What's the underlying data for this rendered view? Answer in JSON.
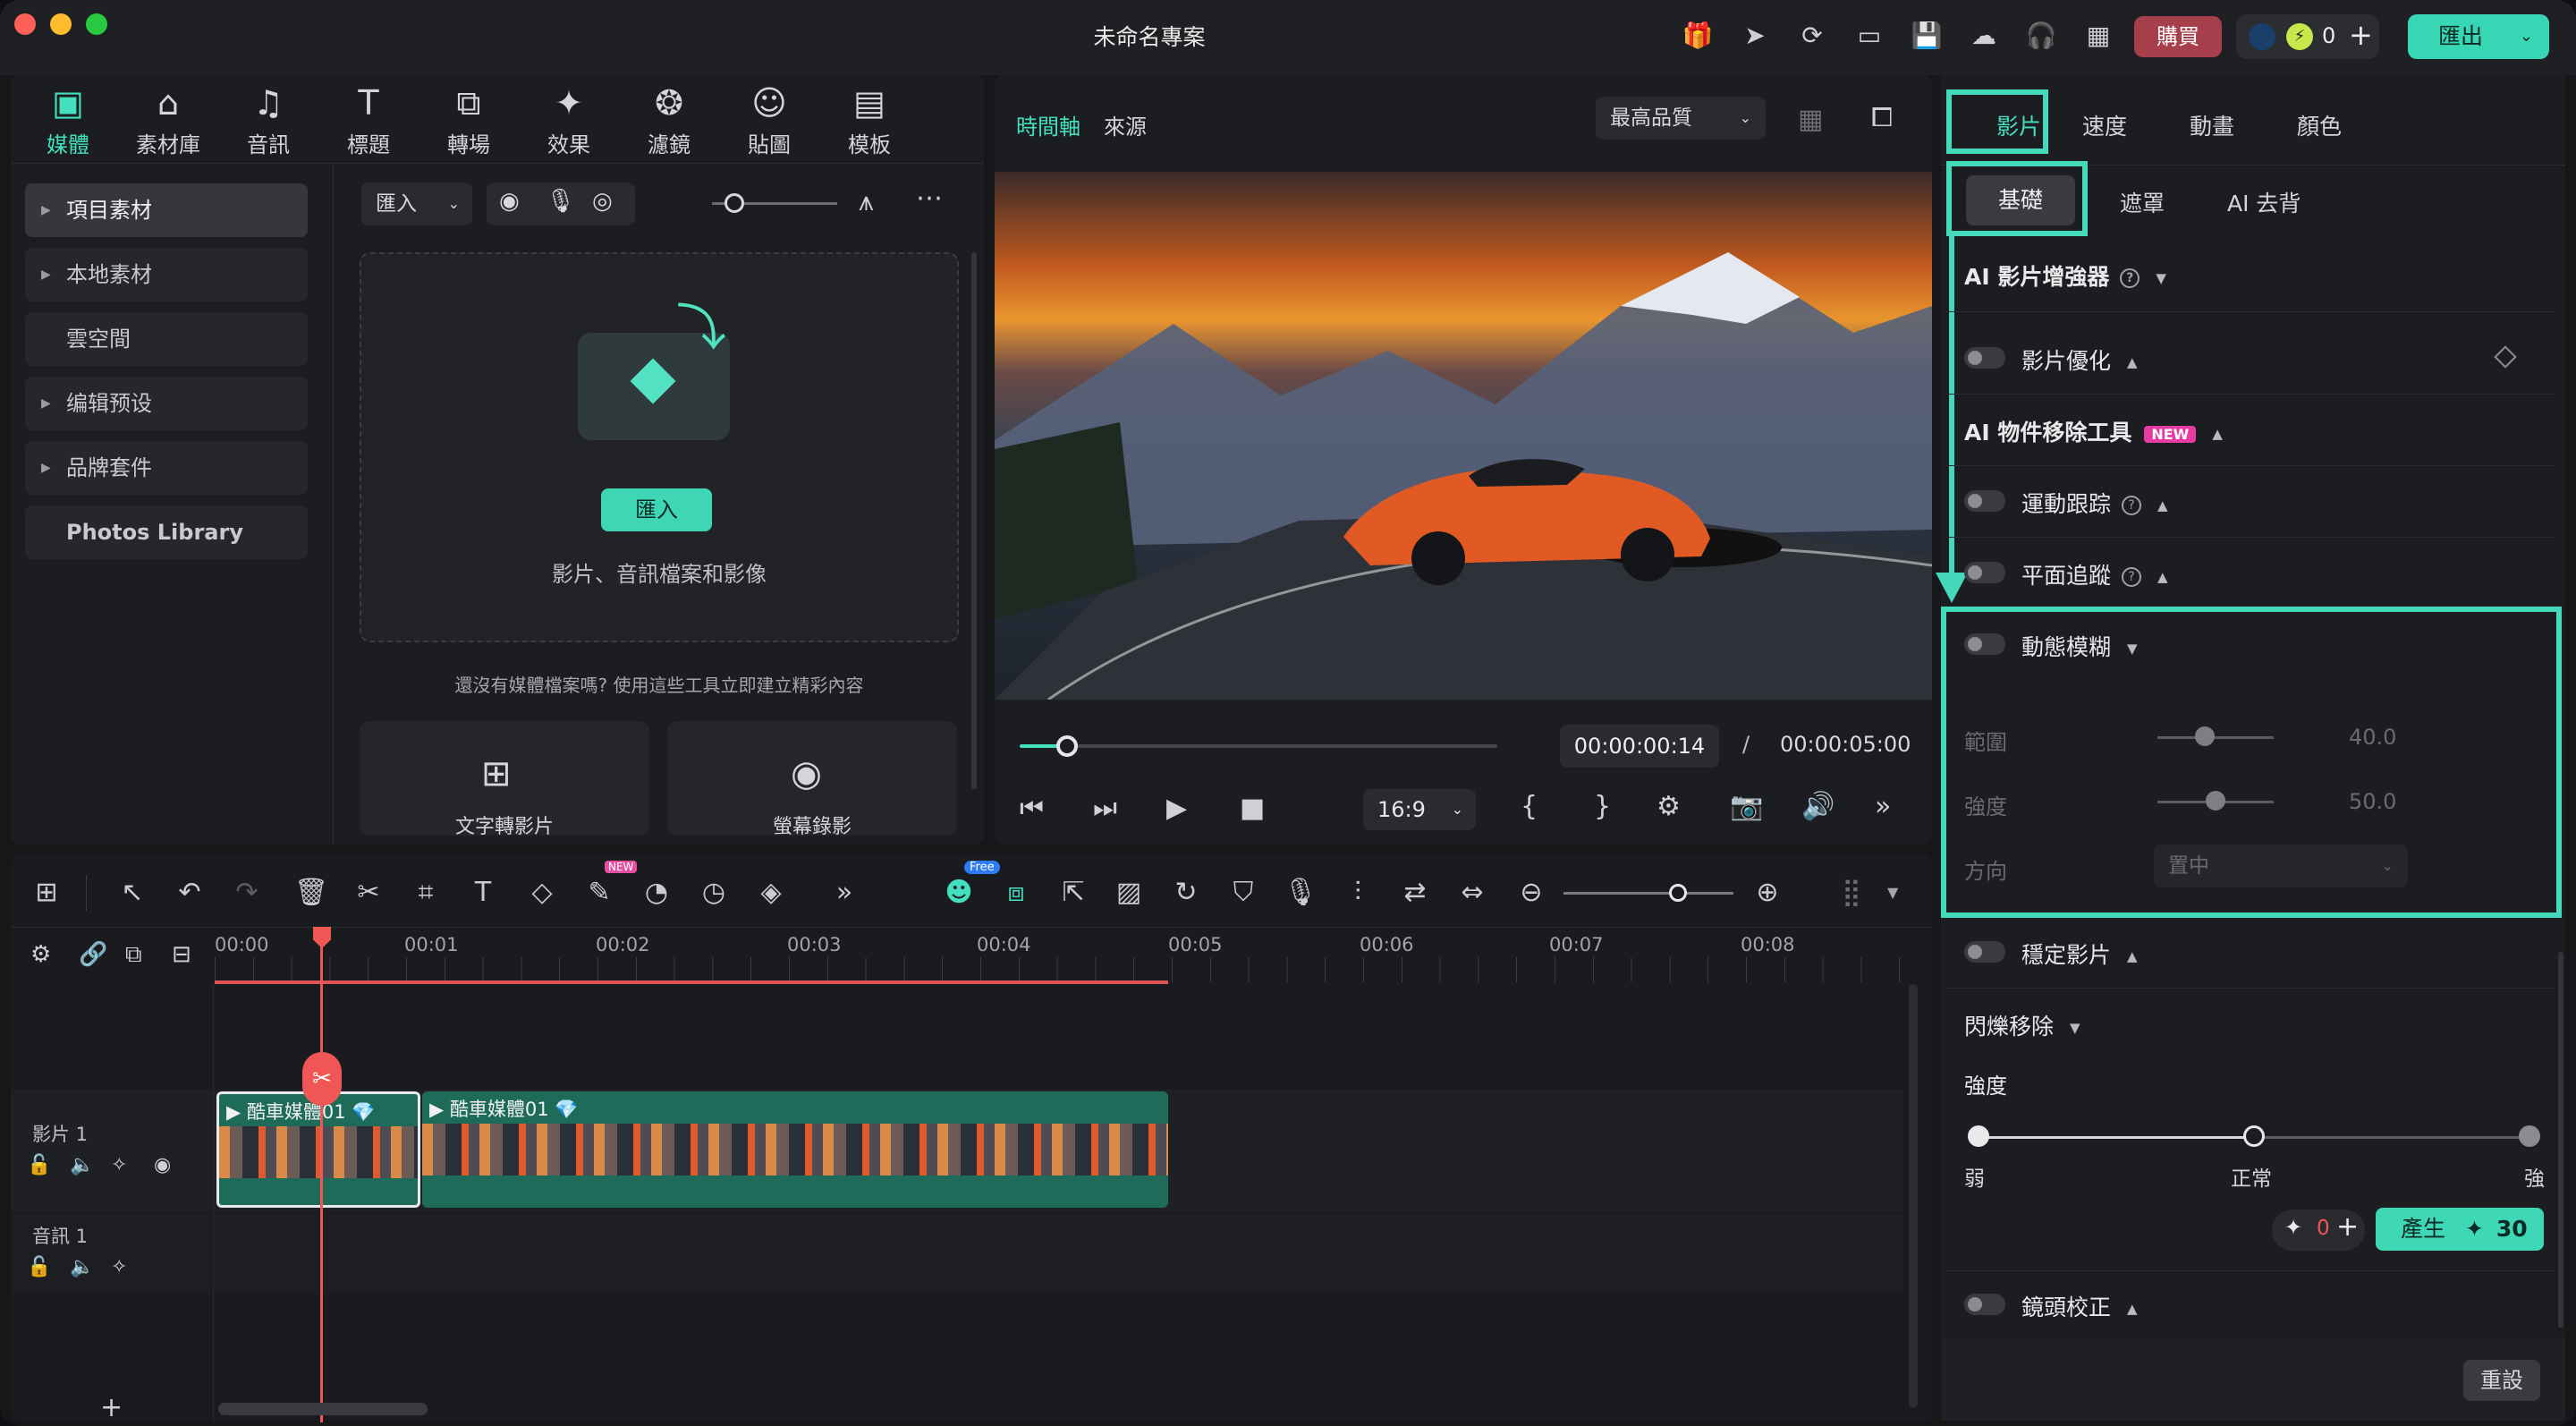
{
  "window": {
    "title": "未命名專案"
  },
  "topbar": {
    "buy": "購買",
    "credits": "0",
    "export": "匯出"
  },
  "media_tabs": [
    {
      "label": "媒體",
      "icon": "media-icon"
    },
    {
      "label": "素材庫",
      "icon": "store-icon"
    },
    {
      "label": "音訊",
      "icon": "music-icon"
    },
    {
      "label": "標題",
      "icon": "title-icon"
    },
    {
      "label": "轉場",
      "icon": "transition-icon"
    },
    {
      "label": "效果",
      "icon": "effects-icon"
    },
    {
      "label": "濾鏡",
      "icon": "filter-icon"
    },
    {
      "label": "貼圖",
      "icon": "sticker-icon"
    },
    {
      "label": "模板",
      "icon": "template-icon"
    }
  ],
  "sidebar": {
    "items": [
      {
        "label": "項目素材"
      },
      {
        "label": "本地素材"
      },
      {
        "label": "雲空間"
      },
      {
        "label": "编辑预设"
      },
      {
        "label": "品牌套件"
      },
      {
        "label": "Photos Library"
      }
    ]
  },
  "media": {
    "import_dropdown": "匯入",
    "import_button": "匯入",
    "drop_hint": "影片、音訊檔案和影像",
    "no_media_hint": "還沒有媒體檔案嗎? 使用這些工具立即建立精彩內容",
    "tool1": "文字轉影片",
    "tool2": "螢幕錄影"
  },
  "preview": {
    "tab_timeline": "時間軸",
    "tab_source": "來源",
    "quality": "最高品質",
    "current_time": "00:00:00:14",
    "separator": "/",
    "total_time": "00:00:05:00",
    "aspect": "16:9",
    "progress": 0.1
  },
  "timeline": {
    "ruler": [
      "00:00",
      "00:01",
      "00:02",
      "00:03",
      "00:04",
      "00:05",
      "00:06",
      "00:07",
      "00:08"
    ],
    "video_track": "影片 1",
    "audio_track": "音訊 1",
    "clip1": "酷車媒體01",
    "clip2": "酷車媒體01",
    "free_badge": "Free",
    "new_badge": "NEW",
    "add": "+"
  },
  "right": {
    "tabs": [
      "影片",
      "速度",
      "動畫",
      "顏色"
    ],
    "subtabs": [
      "基礎",
      "遮罩",
      "AI 去背"
    ],
    "ai_enhancer": "AI 影片增強器",
    "video_optimize": "影片優化",
    "ai_object_remove": "AI 物件移除工具",
    "new_badge": "NEW",
    "motion_tracking": "運動跟踪",
    "plane_tracking": "平面追蹤",
    "motion_blur": "動態模糊",
    "range_label": "範圍",
    "range_value": "40.0",
    "strength_label": "強度",
    "strength_value": "50.0",
    "direction_label": "方向",
    "direction_value": "置中",
    "stabilize": "穩定影片",
    "flicker_remove": "閃爍移除",
    "flicker_strength": "強度",
    "level_weak": "弱",
    "level_normal": "正常",
    "level_strong": "強",
    "credit_count": "0",
    "generate": "產生",
    "generate_cost": "30",
    "lens_correction": "鏡頭校正",
    "reset": "重設"
  },
  "colors": {
    "accent": "#42e0bf",
    "buy": "#a63e4c",
    "playhead": "#f05656",
    "clip": "#1f6b59"
  }
}
